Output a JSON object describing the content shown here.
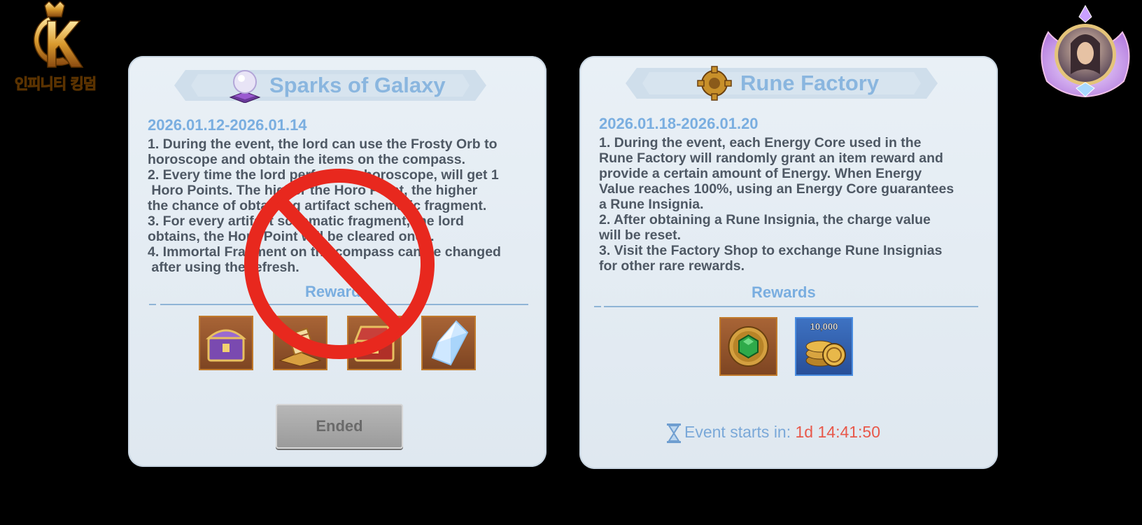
{
  "logo": {
    "text": "인피니티 킹덤",
    "icon": "crown-k-logo-icon"
  },
  "avatar": {
    "icon": "winged-portrait-avatar-icon"
  },
  "panels": [
    {
      "title": "Sparks of Galaxy",
      "icon": "crystal-ball-icon",
      "dates": "2026.01.12-2026.01.14",
      "description": [
        "1. During the event, the lord can use the Frosty Orb to",
        "horoscope and obtain the items on the compass.",
        "2. Every time the lord performs a horoscope, will get 1",
        " Horo Points. The higher the Horo Point, the higher",
        "the chance of obtaining artifact schematic fragment.",
        "3. For every artifact schematic fragment, the lord",
        "obtains, the Horo Point will be cleared once.",
        "4. Immortal Fragment on the compass can be changed",
        " after using the refresh."
      ],
      "rewards_label": "Rewards",
      "rewards": [
        {
          "icon": "purple-treasure-chest-icon"
        },
        {
          "icon": "golden-scroll-pedestal-icon"
        },
        {
          "icon": "red-treasure-chest-icon"
        },
        {
          "icon": "ice-crystal-icon"
        }
      ],
      "button_label": "Ended",
      "overlay_icon": "prohibited-sign-icon"
    },
    {
      "title": "Rune Factory",
      "icon": "golden-gear-icon",
      "dates": "2026.01.18-2026.01.20",
      "description": [
        "1. During the event, each Energy Core used in the",
        "Rune Factory will randomly grant an item reward and",
        "provide a certain amount of Energy. When Energy",
        "Value reaches 100%, using an Energy Core guarantees",
        "a Rune Insignia.",
        "2. After obtaining a Rune Insignia, the charge value",
        "will be reset.",
        "3. Visit the Factory Shop to exchange Rune Insignias",
        "for other rare rewards."
      ],
      "rewards_label": "Rewards",
      "rewards": [
        {
          "icon": "emerald-gear-medallion-icon"
        },
        {
          "icon": "gold-coins-icon",
          "quantity": "10,000"
        }
      ],
      "countdown_label": "Event starts in: ",
      "countdown_value": "1d 14:41:50",
      "countdown_icon": "hourglass-icon"
    }
  ],
  "colors": {
    "accent_blue": "#7aaee0",
    "timer_red": "#e8584a",
    "item_frame": "#c07a2c"
  }
}
